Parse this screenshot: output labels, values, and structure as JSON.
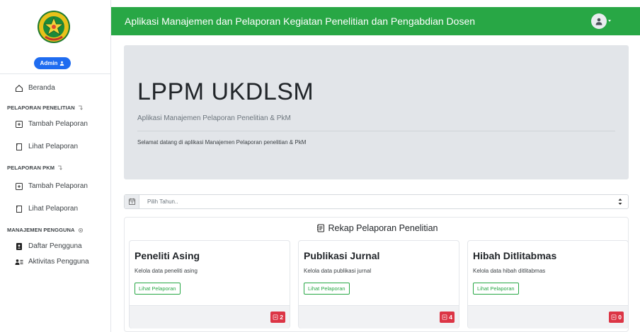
{
  "header": {
    "title": "Aplikasi Manajemen dan Pelaporan Kegiatan Penelitian dan Pengabdian Dosen",
    "accent_color": "#28a745"
  },
  "sidebar": {
    "admin_label": "Admin",
    "beranda": "Beranda",
    "section_penelitian": "PELAPORAN PENELITIAN",
    "penelitian_items": [
      {
        "label": "Tambah Pelaporan",
        "icon": "plus-square-icon"
      },
      {
        "label": "Lihat Pelaporan",
        "icon": "file-icon"
      }
    ],
    "section_pkm": "PELAPORAN PKM",
    "pkm_items": [
      {
        "label": "Tambah Pelaporan",
        "icon": "plus-square-icon"
      },
      {
        "label": "Lihat Pelaporan",
        "icon": "file-icon"
      }
    ],
    "section_manajemen": "MANAJEMEN PENGGUNA",
    "manajemen_items": [
      {
        "label": "Daftar Pengguna",
        "icon": "user-book-icon"
      },
      {
        "label": "Aktivitas Pengguna",
        "icon": "users-list-icon"
      }
    ]
  },
  "jumbotron": {
    "heading": "LPPM UKDLSM",
    "lead": "Aplikasi Manajemen Pelaporan Penelitian & PkM",
    "welcome": "Selamat datang di aplikasi Manajemen Pelaporan penelitian & PkM"
  },
  "year_select": {
    "placeholder": "Pilih Tahun.."
  },
  "rekap": {
    "title": "Rekap Pelaporan Penelitian",
    "cards": [
      {
        "title": "Peneliti Asing",
        "subtitle": "Kelola data peneliti asing",
        "button": "Lihat Pelaporan",
        "count": "2"
      },
      {
        "title": "Publikasi Jurnal",
        "subtitle": "Kelola data publikasi jurnal",
        "button": "Lihat Pelaporan",
        "count": "4"
      },
      {
        "title": "Hibah Ditlitabmas",
        "subtitle": "Kelola data hibah ditlitabmas",
        "button": "Lihat Pelaporan",
        "count": "0"
      }
    ],
    "badge_color": "#dc3545"
  }
}
